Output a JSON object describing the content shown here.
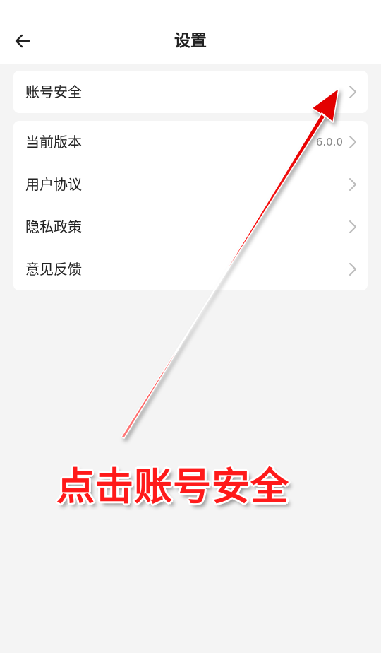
{
  "header": {
    "title": "设置",
    "back_icon": "arrow-left-icon"
  },
  "groups": [
    {
      "items": [
        {
          "label": "账号安全",
          "value": ""
        }
      ]
    },
    {
      "items": [
        {
          "label": "当前版本",
          "value": "6.0.0"
        },
        {
          "label": "用户协议",
          "value": ""
        },
        {
          "label": "隐私政策",
          "value": ""
        },
        {
          "label": "意见反馈",
          "value": ""
        }
      ]
    }
  ],
  "annotation": {
    "text": "点击账号安全",
    "color": "#ff1a1a"
  }
}
